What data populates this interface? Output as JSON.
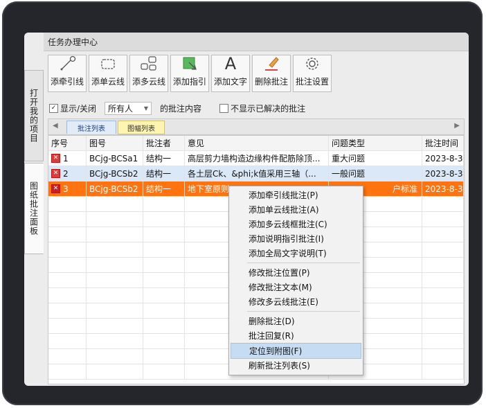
{
  "panel_title": "任务办理中心",
  "side_tabs": [
    "打开我的项目",
    "图纸批注面板"
  ],
  "toolbar": [
    {
      "label": "添牵引线",
      "icon": "leader-line-icon"
    },
    {
      "label": "添单云线",
      "icon": "single-cloud-icon"
    },
    {
      "label": "添多云线",
      "icon": "multi-cloud-icon"
    },
    {
      "label": "添加指引",
      "icon": "guide-icon"
    },
    {
      "label": "添加文字",
      "icon": "text-A-icon"
    },
    {
      "label": "删除批注",
      "icon": "eraser-icon"
    },
    {
      "label": "批注设置",
      "icon": "gear-icon"
    }
  ],
  "options": {
    "show_toggle": "显示/关闭",
    "owner_select": "所有人",
    "suffix": "的批注内容",
    "hide_resolved": "不显示已解决的批注"
  },
  "tabs": [
    "批注列表",
    "图幅列表"
  ],
  "table": {
    "headers": [
      "序号",
      "图号",
      "批注者",
      "意见",
      "问题类型",
      "批注时间"
    ],
    "rows": [
      [
        "1",
        "BCjg-BCSa1",
        "结构一",
        "高层剪力墙构造边缘构件配筋除顶...",
        "重大问题",
        "2023-8-3"
      ],
      [
        "2",
        "BCjg-BCSb2",
        "结构一",
        "各土层Ck、&phi;k值采用三轴（...",
        "一般问题",
        "2023-8-3"
      ],
      [
        "3",
        "BCjg-BCSb2",
        "结构一",
        "地下室原则",
        "户标准",
        "2023-8-3"
      ]
    ]
  },
  "context_menu": {
    "groups": [
      [
        "添加牵引线批注(P)",
        "添加单云线批注(A)",
        "添加多云线框批注(C)",
        "添加说明指引批注(I)",
        "添加全局文字说明(T)"
      ],
      [
        "修改批注位置(P)",
        "修改批注文本(M)",
        "修改多云线批注(E)"
      ],
      [
        "删除批注(D)",
        "批注回复(R)",
        "定位到附图(F)",
        "刷新批注列表(S)"
      ]
    ],
    "highlighted": "定位到附图(F)"
  },
  "colors": {
    "selected_row": "#ff7410",
    "alt_row": "#dbe8f7",
    "menu_highlight": "#c6dcf3"
  }
}
